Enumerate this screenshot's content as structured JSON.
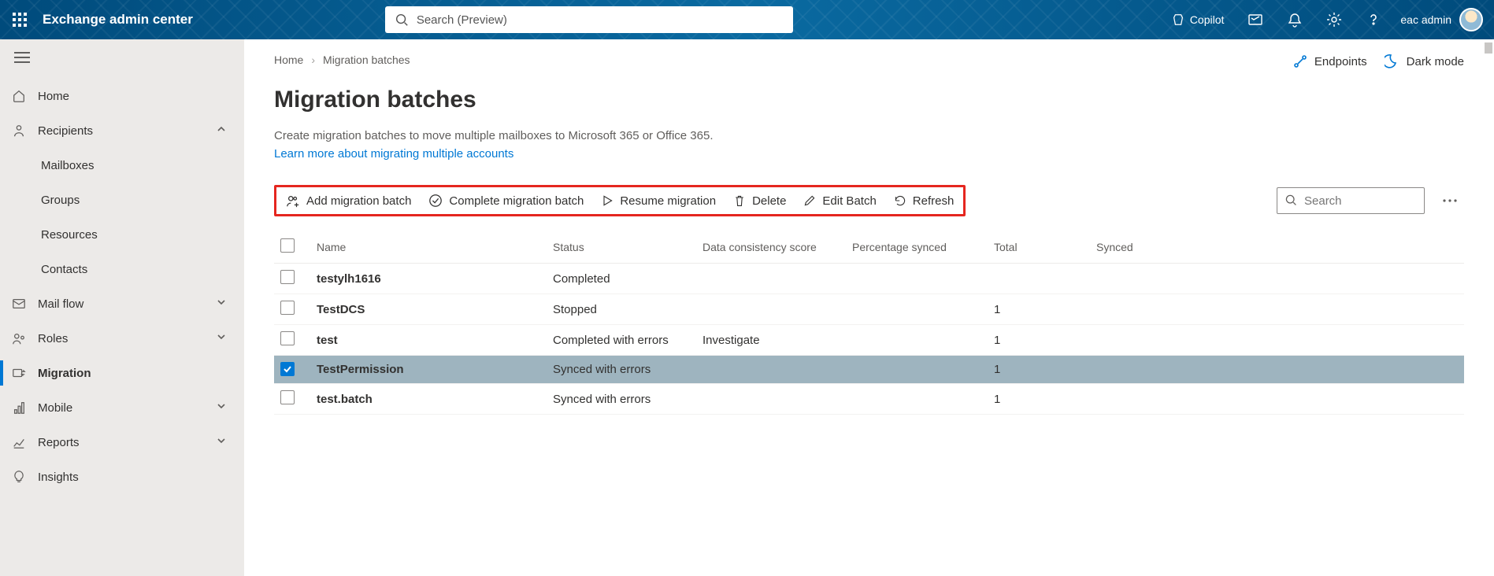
{
  "header": {
    "app_title": "Exchange admin center",
    "search_placeholder": "Search (Preview)",
    "copilot": "Copilot",
    "user_name": "eac admin"
  },
  "top_actions": {
    "endpoints": "Endpoints",
    "dark_mode": "Dark mode"
  },
  "sidebar": {
    "home": "Home",
    "recipients": "Recipients",
    "mailboxes": "Mailboxes",
    "groups": "Groups",
    "resources": "Resources",
    "contacts": "Contacts",
    "mail_flow": "Mail flow",
    "roles": "Roles",
    "migration": "Migration",
    "mobile": "Mobile",
    "reports": "Reports",
    "insights": "Insights"
  },
  "breadcrumb": {
    "home": "Home",
    "current": "Migration batches"
  },
  "page": {
    "title": "Migration batches",
    "desc": "Create migration batches to move multiple mailboxes to Microsoft 365 or Office 365.",
    "learn_more": "Learn more about migrating multiple accounts"
  },
  "toolbar": {
    "add": "Add migration batch",
    "complete": "Complete migration batch",
    "resume": "Resume migration",
    "delete": "Delete",
    "edit": "Edit Batch",
    "refresh": "Refresh",
    "search_placeholder": "Search"
  },
  "table": {
    "columns": {
      "name": "Name",
      "status": "Status",
      "dcs": "Data consistency score",
      "percent": "Percentage synced",
      "total": "Total",
      "synced": "Synced"
    },
    "rows": [
      {
        "name": "testylh1616",
        "status": "Completed",
        "dcs": "",
        "percent": "",
        "total": "",
        "synced": "",
        "selected": false
      },
      {
        "name": "TestDCS",
        "status": "Stopped",
        "dcs": "",
        "percent": "",
        "total": "1",
        "synced": "",
        "selected": false
      },
      {
        "name": "test",
        "status": "Completed with errors",
        "dcs": "Investigate",
        "percent": "",
        "total": "1",
        "synced": "",
        "selected": false
      },
      {
        "name": "TestPermission",
        "status": "Synced with errors",
        "dcs": "",
        "percent": "",
        "total": "1",
        "synced": "",
        "selected": true
      },
      {
        "name": "test.batch",
        "status": "Synced with errors",
        "dcs": "",
        "percent": "",
        "total": "1",
        "synced": "",
        "selected": false
      }
    ]
  }
}
